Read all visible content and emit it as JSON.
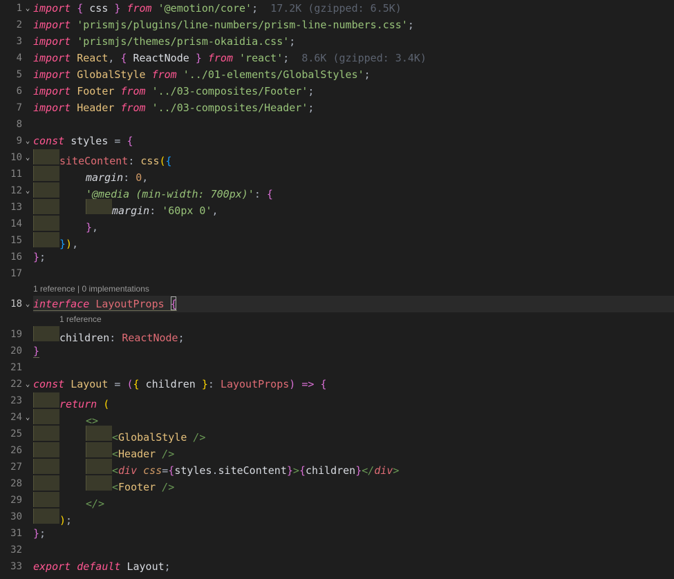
{
  "gutter": {
    "1": "1",
    "2": "2",
    "3": "3",
    "4": "4",
    "5": "5",
    "6": "6",
    "7": "7",
    "8": "8",
    "9": "9",
    "10": "10",
    "11": "11",
    "12": "12",
    "13": "13",
    "14": "14",
    "15": "15",
    "16": "16",
    "17": "17",
    "18": "18",
    "19": "19",
    "20": "20",
    "21": "21",
    "22": "22",
    "23": "23",
    "24": "24",
    "25": "25",
    "26": "26",
    "27": "27",
    "28": "28",
    "29": "29",
    "30": "30",
    "31": "31",
    "32": "32",
    "33": "33"
  },
  "fold_glyph": "⌄",
  "codelens": {
    "interface": "1 reference | 0 implementations",
    "children": "1 reference"
  },
  "hints": {
    "emotion": "17.2K (gzipped: 6.5K)",
    "react": "8.6K (gzipped: 3.4K)"
  },
  "kw": {
    "import": "import",
    "from": "from",
    "const": "const",
    "interface": "interface",
    "return": "return",
    "export": "export",
    "default_": "default"
  },
  "sym": {
    "lbrace": "{",
    "rbrace": "}",
    "lparen": "(",
    "rparen": ")",
    "semi": ";",
    "comma": ",",
    "colon": ":",
    "eq": "=",
    "arrow": "=>",
    "dot": ".",
    "lt": "<",
    "gt": ">",
    "gt_slash": "/>",
    "lt_slash": "</",
    "frag_open": "<>",
    "frag_close": "</>",
    "zero": "0"
  },
  "ident": {
    "css": "css",
    "React": "React",
    "ReactNode": "ReactNode",
    "GlobalStyle": "GlobalStyle",
    "Footer": "Footer",
    "Header": "Header",
    "styles": "styles",
    "siteContent": "siteContent",
    "margin": "margin",
    "LayoutProps": "LayoutProps",
    "children": "children",
    "Layout": "Layout",
    "div": "div"
  },
  "str": {
    "emotion_core": "'@emotion/core'",
    "prism_line_numbers": "'prismjs/plugins/line-numbers/prism-line-numbers.css'",
    "prism_okaidia": "'prismjs/themes/prism-okaidia.css'",
    "react": "'react'",
    "global_styles": "'../01-elements/GlobalStyles'",
    "footer": "'../03-composites/Footer'",
    "header": "'../03-composites/Header'",
    "media": "'@media (min-width: 700px)'",
    "margin_60": "'60px 0'"
  }
}
